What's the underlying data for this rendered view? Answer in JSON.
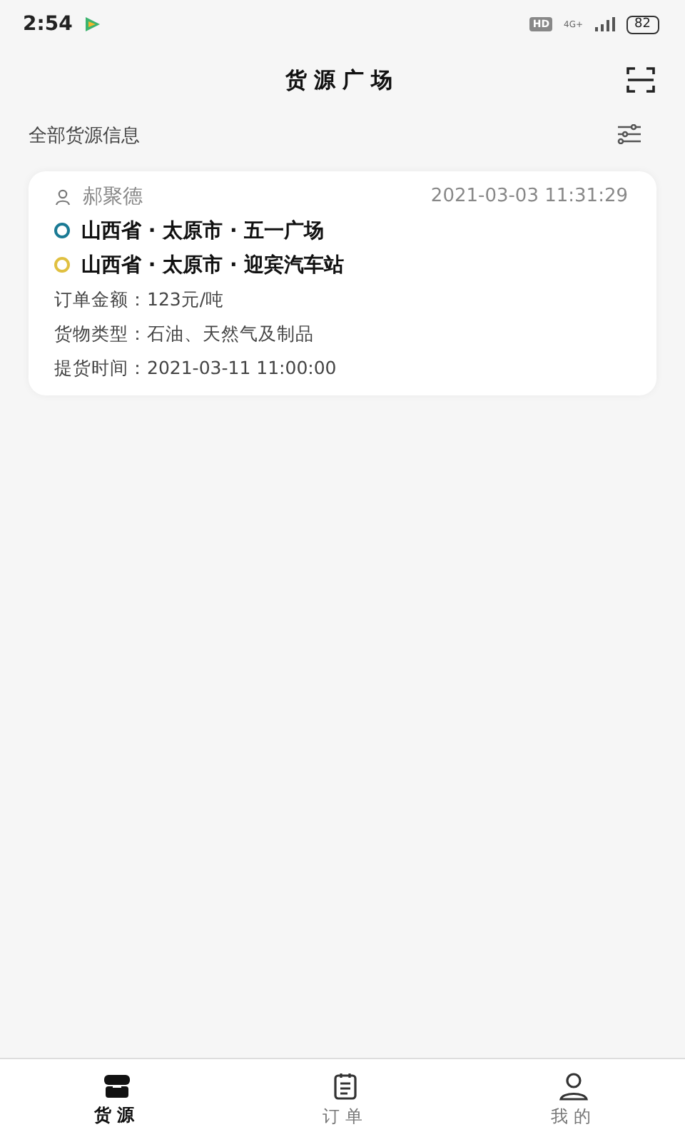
{
  "status_bar": {
    "time": "2:54",
    "hd": "HD",
    "network": "4G+",
    "battery": "82"
  },
  "header": {
    "title": "货源广场"
  },
  "section": {
    "title": "全部货源信息"
  },
  "cards": [
    {
      "person": "郝聚德",
      "time": "2021-03-03 11:31:29",
      "stops": [
        {
          "text": "山西省 · 太原市 · 五一广场",
          "color": "#1a7a94"
        },
        {
          "text": "山西省 · 太原市 · 迎宾汽车站",
          "color": "#e0c040"
        }
      ],
      "details": [
        "订单金额：123元/吨",
        "货物类型：石油、天然气及制品",
        "提货时间：2021-03-11 11:00:00"
      ]
    }
  ],
  "tabs": [
    {
      "label": "货源",
      "kind": "shop",
      "selected": true
    },
    {
      "label": "订单",
      "kind": "notes",
      "selected": false
    },
    {
      "label": "我的",
      "kind": "user",
      "selected": false
    }
  ]
}
